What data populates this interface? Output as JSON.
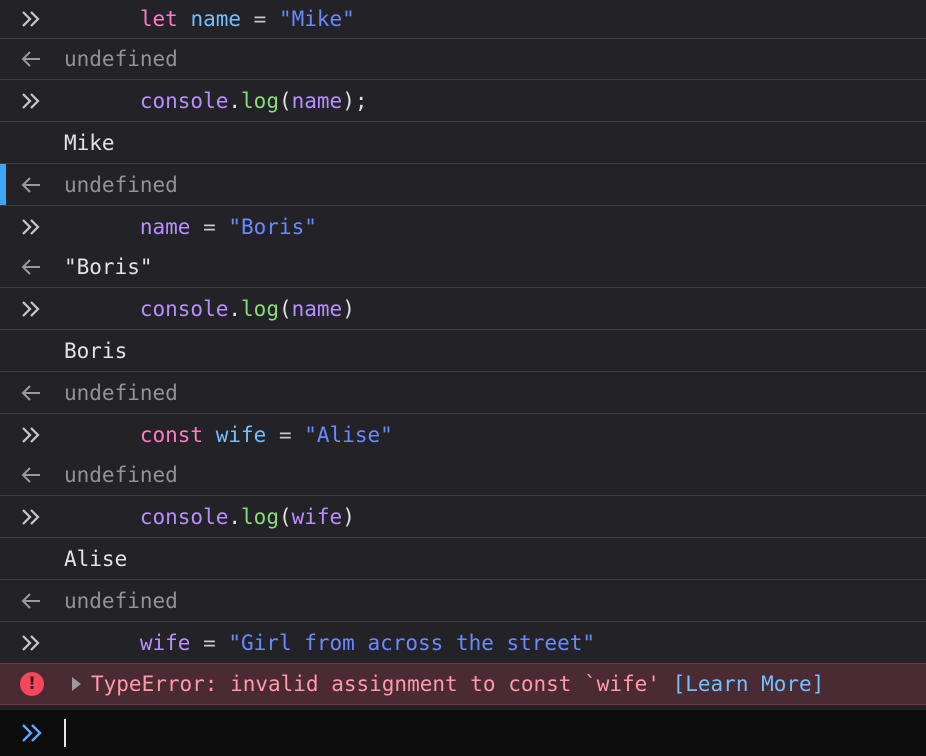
{
  "rows": [
    {
      "tokens": [
        [
          "let",
          "kw"
        ],
        [
          " ",
          "op"
        ],
        [
          "name",
          "var"
        ],
        [
          " = ",
          "op"
        ],
        [
          "\"Mike\"",
          "str"
        ]
      ]
    },
    {
      "text": "undefined"
    },
    {
      "tokens": [
        [
          "console",
          "fn"
        ],
        [
          ".",
          "punc"
        ],
        [
          "log",
          "call"
        ],
        [
          "(",
          "punc"
        ],
        [
          "name",
          "fn"
        ],
        [
          ");",
          "punc"
        ]
      ]
    },
    {
      "text": "Mike"
    },
    {
      "text": "undefined"
    },
    {
      "tokens": [
        [
          "name",
          "fn"
        ],
        [
          " = ",
          "op"
        ],
        [
          "\"Boris\"",
          "str"
        ]
      ]
    },
    {
      "text": "\"Boris\""
    },
    {
      "tokens": [
        [
          "console",
          "fn"
        ],
        [
          ".",
          "punc"
        ],
        [
          "log",
          "call"
        ],
        [
          "(",
          "punc"
        ],
        [
          "name",
          "fn"
        ],
        [
          ")",
          "punc"
        ]
      ]
    },
    {
      "text": "Boris"
    },
    {
      "text": "undefined"
    },
    {
      "tokens": [
        [
          "const",
          "kw"
        ],
        [
          " ",
          "op"
        ],
        [
          "wife",
          "var"
        ],
        [
          " = ",
          "op"
        ],
        [
          "\"Alise\"",
          "str"
        ]
      ]
    },
    {
      "text": "undefined"
    },
    {
      "tokens": [
        [
          "console",
          "fn"
        ],
        [
          ".",
          "punc"
        ],
        [
          "log",
          "call"
        ],
        [
          "(",
          "punc"
        ],
        [
          "wife",
          "fn"
        ],
        [
          ")",
          "punc"
        ]
      ]
    },
    {
      "text": "Alise"
    },
    {
      "text": "undefined"
    },
    {
      "tokens": [
        [
          "wife",
          "fn"
        ],
        [
          " = ",
          "op"
        ],
        [
          "\"Girl from across the street\"",
          "str"
        ]
      ]
    }
  ],
  "error": {
    "icon": "!",
    "message": "TypeError: invalid assignment to const `wife'",
    "learn_more": "[Learn More]"
  },
  "prompt_input": {
    "value": ""
  },
  "icons": {
    "input": "chevrons-right-icon",
    "result": "arrow-left-icon",
    "error": "error-circle-icon",
    "expand": "triangle-right-icon"
  },
  "colors": {
    "background": "#232327",
    "keyword": "#ff79c6",
    "string": "#6b89ff",
    "function_call": "#86de74",
    "identifier": "#b98eff",
    "selection_marker": "#3ea6f2",
    "error_background": "#4a2a33"
  }
}
